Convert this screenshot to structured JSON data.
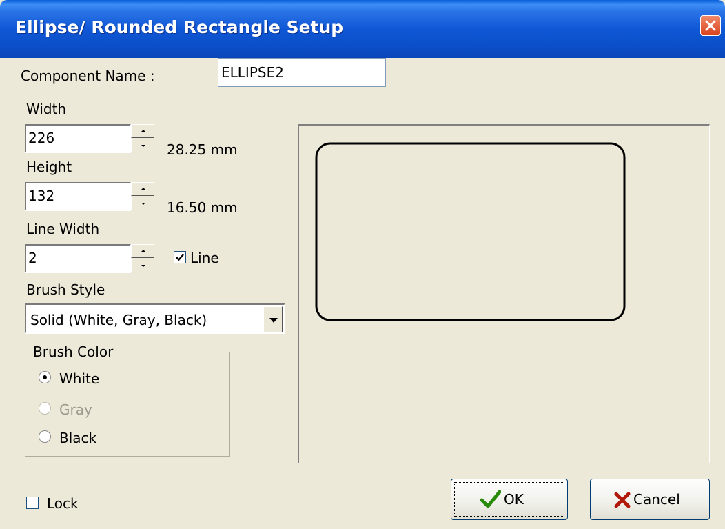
{
  "window": {
    "title": "Ellipse/ Rounded Rectangle Setup"
  },
  "component": {
    "label": "Component Name :",
    "value": "ELLIPSE2"
  },
  "width": {
    "label": "Width",
    "value": "226",
    "mm": "28.25 mm"
  },
  "height": {
    "label": "Height",
    "value": "132",
    "mm": "16.50 mm"
  },
  "line_width": {
    "label": "Line Width",
    "value": "2",
    "line_label": "Line",
    "line_checked": true
  },
  "brush_style": {
    "label": "Brush Style",
    "value": "Solid (White, Gray, Black)"
  },
  "brush_color": {
    "label": "Brush Color",
    "options": [
      {
        "label": "White",
        "selected": true,
        "enabled": true
      },
      {
        "label": "Gray",
        "selected": false,
        "enabled": false
      },
      {
        "label": "Black",
        "selected": false,
        "enabled": true
      }
    ]
  },
  "lock": {
    "label": "Lock",
    "checked": false
  },
  "buttons": {
    "ok": "OK",
    "cancel": "Cancel"
  },
  "icons": {
    "close": "close-icon",
    "ok": "check-icon",
    "cancel": "x-icon",
    "spin_up": "spin-up-icon",
    "spin_down": "spin-down-icon",
    "dropdown": "chevron-down-icon"
  }
}
